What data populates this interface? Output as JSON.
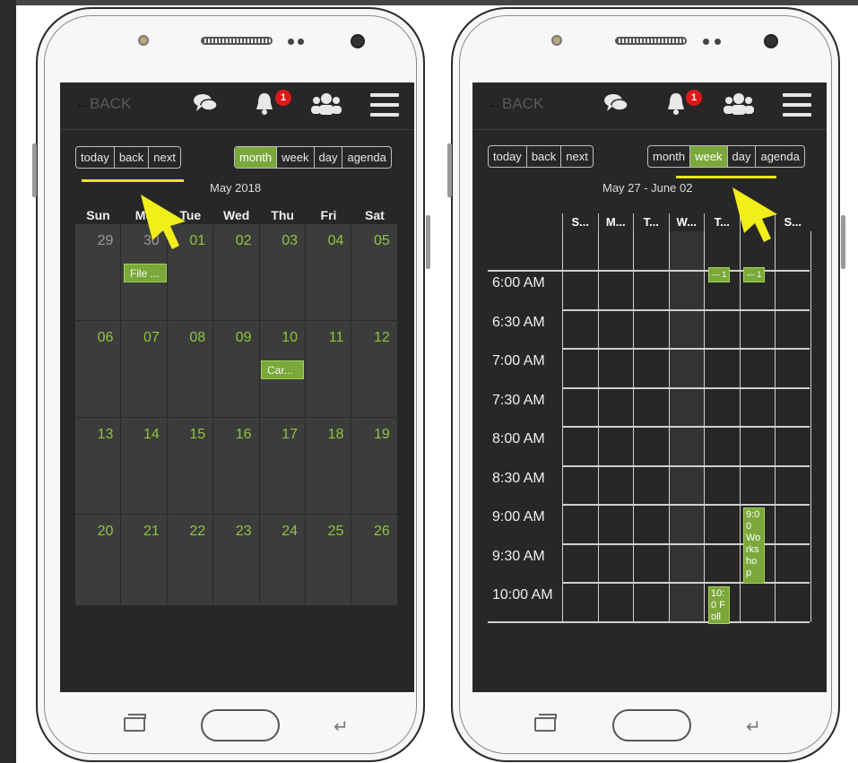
{
  "header": {
    "back_label": "BACK",
    "back_arrow": "←",
    "notification_count": "1",
    "icons": [
      "chat-bubbles-icon",
      "bell-icon",
      "group-users-icon",
      "hamburger-menu-icon"
    ]
  },
  "nav": {
    "today": "today",
    "back": "back",
    "next": "next"
  },
  "views": {
    "month": "month",
    "week": "week",
    "day": "day",
    "agenda": "agenda"
  },
  "month_view": {
    "title": "May 2018",
    "active_view": "month",
    "weekdays": [
      "Sun",
      "Mo",
      "Tue",
      "Wed",
      "Thu",
      "Fri",
      "Sat"
    ],
    "weeks": [
      [
        "29",
        "30",
        "01",
        "02",
        "03",
        "04",
        "05"
      ],
      [
        "06",
        "07",
        "08",
        "09",
        "10",
        "11",
        "12"
      ],
      [
        "13",
        "14",
        "15",
        "16",
        "17",
        "18",
        "19"
      ],
      [
        "20",
        "21",
        "22",
        "23",
        "24",
        "25",
        "26"
      ]
    ],
    "events": [
      {
        "label": "File ...",
        "date": "30"
      },
      {
        "label": "Car...",
        "date": "10"
      }
    ]
  },
  "week_view": {
    "title": "May 27 - June 02",
    "active_view": "week",
    "day_headers": [
      "S...",
      "M...",
      "T...",
      "W...",
      "T...",
      "",
      "S..."
    ],
    "times": [
      "6:00 AM",
      "6:30 AM",
      "7:00 AM",
      "7:30 AM",
      "8:00 AM",
      "8:30 AM",
      "9:00 AM",
      "9:30 AM",
      "10:00 AM"
    ],
    "events": [
      {
        "label": "— 1",
        "day_index": 4
      },
      {
        "label": "— 1",
        "day_index": 5
      },
      {
        "label": "9:00 Workshop",
        "day_index": 5
      },
      {
        "label": "10:0 Foll",
        "day_index": 4
      }
    ]
  },
  "colors": {
    "accent": "#7ba83a",
    "day_number": "#8dc63f",
    "highlight": "#e9e321",
    "badge": "#e01818",
    "screen": "#272727"
  },
  "bottom_nav": {
    "back_symbol": "↵"
  }
}
